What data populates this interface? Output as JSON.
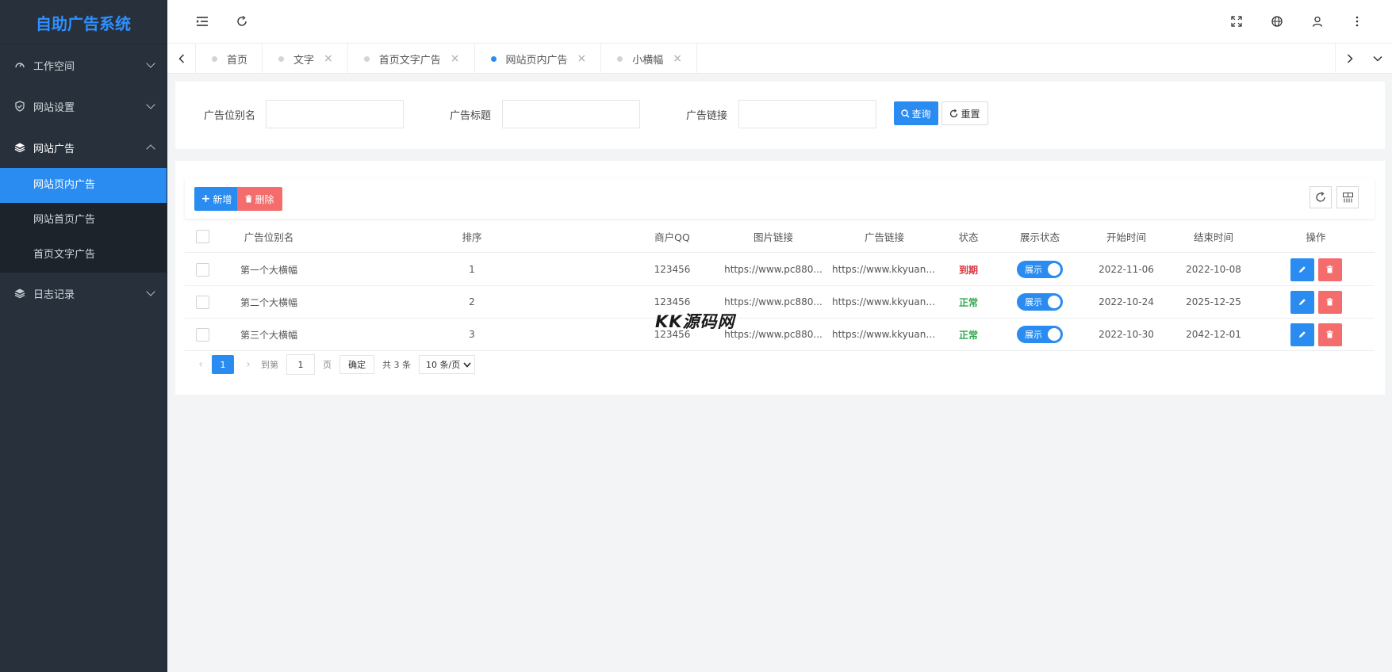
{
  "app": {
    "title": "自助广告系统"
  },
  "colors": {
    "accent": "#2a8cf0",
    "danger": "#f56c6c",
    "sidebar_bg": "#28313b",
    "success": "#2fa84f",
    "expired": "#d9343e"
  },
  "sidebar": {
    "items": [
      {
        "label": "工作空间",
        "icon": "dashboard-icon"
      },
      {
        "label": "网站设置",
        "icon": "shield-check-icon"
      },
      {
        "label": "网站广告",
        "icon": "layers-icon",
        "children": [
          {
            "label": "网站页内广告",
            "active": true
          },
          {
            "label": "网站首页广告"
          },
          {
            "label": "首页文字广告"
          }
        ]
      },
      {
        "label": "日志记录",
        "icon": "layers-icon"
      }
    ]
  },
  "tabs": [
    {
      "label": "首页"
    },
    {
      "label": "文字",
      "close": "×"
    },
    {
      "label": "首页文字广告",
      "close": "×"
    },
    {
      "label": "网站页内广告",
      "close": "×",
      "active": true
    },
    {
      "label": "小横幅",
      "close": "×"
    }
  ],
  "search": {
    "name_label": "广告位别名",
    "title_label": "广告标题",
    "link_label": "广告链接",
    "query_btn": "查询",
    "reset_btn": "重置"
  },
  "toolbar": {
    "add_btn": "新增",
    "delete_btn": "删除"
  },
  "table": {
    "headers": {
      "name": "广告位别名",
      "sort": "排序",
      "qq": "商户QQ",
      "img": "图片链接",
      "link": "广告链接",
      "status": "状态",
      "show": "展示状态",
      "start": "开始时间",
      "end": "结束时间",
      "op": "操作"
    },
    "rows": [
      {
        "name": "第一个大横幅",
        "sort": "1",
        "qq": "123456",
        "img": "https://www.pc880...",
        "link": "https://www.kkyuanma...",
        "status": "到期",
        "status_type": "expired",
        "show": "展示",
        "start": "2022-11-06",
        "end": "2022-10-08"
      },
      {
        "name": "第二个大横幅",
        "sort": "2",
        "qq": "123456",
        "img": "https://www.pc880...",
        "link": "https://www.kkyuanma...",
        "status": "正常",
        "status_type": "normal",
        "show": "展示",
        "start": "2022-10-24",
        "end": "2025-12-25"
      },
      {
        "name": "第三个大横幅",
        "sort": "3",
        "qq": "123456",
        "img": "https://www.pc880...",
        "link": "https://www.kkyuanma...",
        "status": "正常",
        "status_type": "normal",
        "show": "展示",
        "start": "2022-10-30",
        "end": "2042-12-01"
      }
    ]
  },
  "pager": {
    "current": "1",
    "goto_label": "到第",
    "goto_value": "1",
    "page_unit": "页",
    "confirm": "确定",
    "total": "共 3 条",
    "page_size": "10 条/页"
  },
  "watermark": "KK源码网"
}
